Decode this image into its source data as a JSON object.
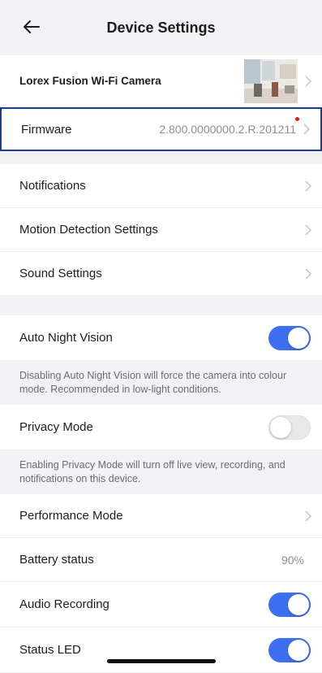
{
  "header": {
    "title": "Device Settings",
    "back_icon": "arrow-left-icon"
  },
  "camera": {
    "name": "Lorex Fusion Wi-Fi Camera"
  },
  "firmware": {
    "label": "Firmware",
    "value": "2.800.0000000.2.R.201211"
  },
  "menu": {
    "notifications": "Notifications",
    "motion": "Motion Detection Settings",
    "sound": "Sound Settings"
  },
  "night_vision": {
    "label": "Auto Night Vision",
    "enabled": true,
    "note": "Disabling Auto Night Vision will force the camera into colour mode. Recommended in low-light conditions."
  },
  "privacy": {
    "label": "Privacy Mode",
    "enabled": false,
    "note": "Enabling Privacy Mode will turn off live view, recording, and notifications on this device."
  },
  "performance": {
    "label": "Performance Mode"
  },
  "battery": {
    "label": "Battery status",
    "value": "90%"
  },
  "audio": {
    "label": "Audio Recording",
    "enabled": true
  },
  "led": {
    "label": "Status LED",
    "enabled": true
  },
  "colors": {
    "accent": "#3c6ff0",
    "highlight_border": "#1a3d8f",
    "background": "#f2f2f4"
  }
}
